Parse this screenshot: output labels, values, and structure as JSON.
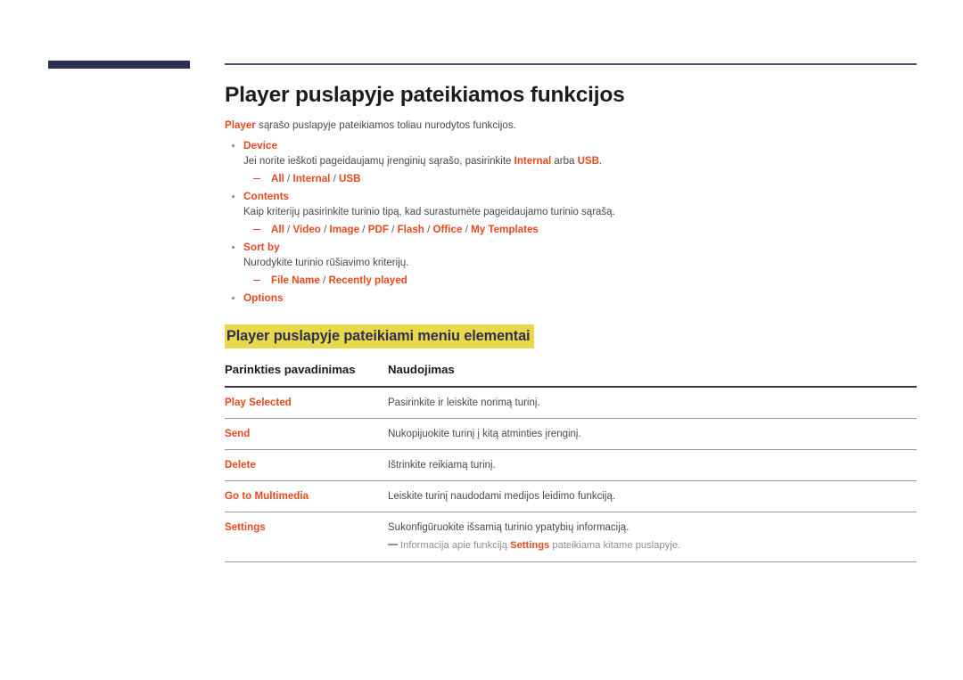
{
  "header": {
    "bar_color": "#2e3053",
    "rule_color": "#514f68"
  },
  "accent_color": "#e8491e",
  "highlight_color": "#e8d84a",
  "page_title": "Player puslapyje pateikiamos funkcijos",
  "intro": {
    "lead": "Player",
    "rest": " sąrašo puslapyje pateikiamos toliau nurodytos funkcijos."
  },
  "bullets": [
    {
      "title": "Device",
      "desc_part1": "Jei norite ieškoti pageidaujamų įrenginių sąrašo, pasirinkite ",
      "desc_hl1": "Internal",
      "desc_part2": " arba ",
      "desc_hl2": "USB",
      "desc_part3": ".",
      "options": "All / Internal / USB"
    },
    {
      "title": "Contents",
      "desc_part1": "Kaip kriterijų pasirinkite turinio tipą, kad surastumėte pageidaujamo turinio sąrašą.",
      "desc_hl1": "",
      "desc_part2": "",
      "desc_hl2": "",
      "desc_part3": "",
      "options": "All / Video / Image / PDF / Flash / Office / My Templates"
    },
    {
      "title": "Sort by",
      "desc_part1": "Nurodykite turinio rūšiavimo kriterijų.",
      "desc_hl1": "",
      "desc_part2": "",
      "desc_hl2": "",
      "desc_part3": "",
      "options": "File Name / Recently played"
    },
    {
      "title": "Options",
      "desc_part1": "",
      "desc_hl1": "",
      "desc_part2": "",
      "desc_hl2": "",
      "desc_part3": "",
      "options": ""
    }
  ],
  "section_heading": "Player puslapyje pateikiami meniu elementai",
  "table": {
    "columns": [
      "Parinkties pavadinimas",
      "Naudojimas"
    ],
    "rows": [
      {
        "name": "Play Selected",
        "use": "Pasirinkite ir leiskite norimą turinį."
      },
      {
        "name": "Send",
        "use": "Nukopijuokite turinį į kitą atminties įrenginį."
      },
      {
        "name": "Delete",
        "use": "Ištrinkite reikiamą turinį."
      },
      {
        "name": "Go to Multimedia",
        "use": "Leiskite turinį naudodami medijos leidimo funkciją."
      },
      {
        "name": "Settings",
        "use": "Sukonfigūruokite išsamią turinio ypatybių informaciją."
      }
    ],
    "settings_note": {
      "part1": "Informacija apie funkciją ",
      "bold": "Settings",
      "part2": " pateikiama kitame puslapyje."
    }
  }
}
